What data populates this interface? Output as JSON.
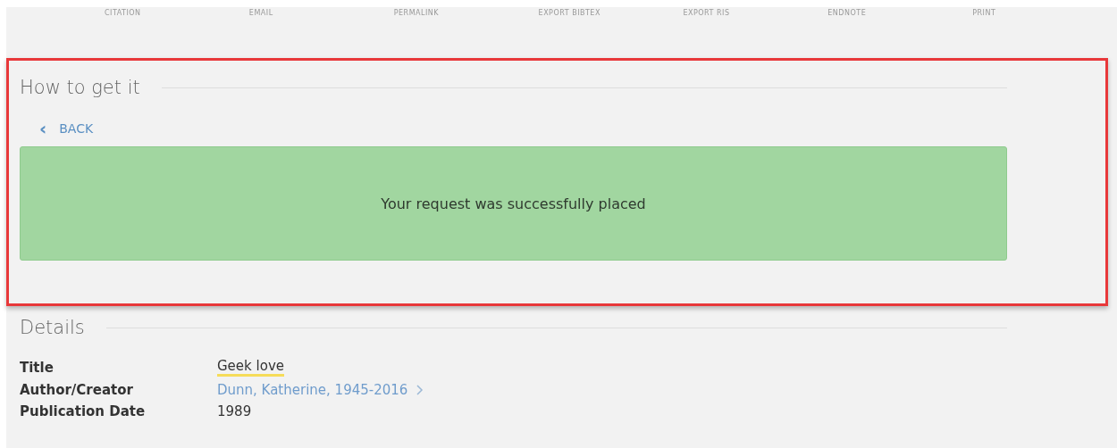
{
  "actions": [
    "CITATION",
    "EMAIL",
    "PERMALINK",
    "EXPORT BIBTEX",
    "EXPORT RIS",
    "ENDNOTE",
    "PRINT"
  ],
  "how_to_get_it": {
    "heading": "How to get it",
    "back": {
      "icon": "‹",
      "label": "BACK"
    },
    "message": "Your request was successfully placed"
  },
  "details": {
    "heading": "Details",
    "rows": [
      {
        "label": "Title",
        "value": "Geek love",
        "kind": "highlight"
      },
      {
        "label": "Author/Creator",
        "value": "Dunn, Katherine, 1945-2016",
        "kind": "link"
      },
      {
        "label": "Publication Date",
        "value": "1989",
        "kind": "text"
      }
    ]
  }
}
